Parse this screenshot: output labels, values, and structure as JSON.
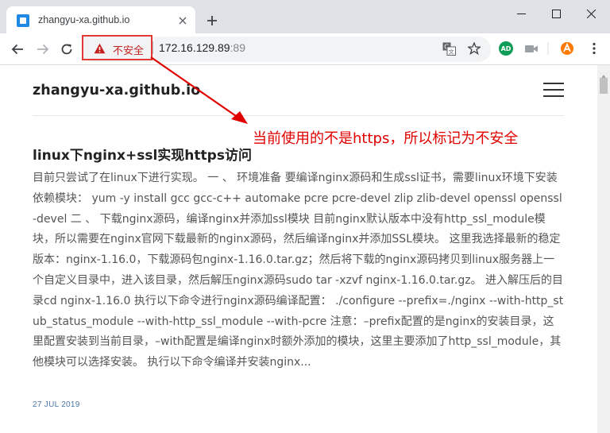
{
  "browser": {
    "tab": {
      "title": "zhangyu-xa.github.io",
      "favicon": "site-favicon"
    },
    "security_label": "不安全",
    "url": {
      "host": "172.16.129.89",
      "port": ":89"
    },
    "colors": {
      "insecure": "#c5221f",
      "annotation": "#e00000",
      "date": "#4a76a8"
    }
  },
  "site": {
    "title": "zhangyu-xa.github.io"
  },
  "post": {
    "title": "linux下nginx+ssl实现https访问",
    "excerpt": "目前只尝试了在linux下进行实现。 一 、 环境准备 要编译nginx源码和生成ssl证书，需要linux环境下安装依赖模块： yum -y install gcc gcc-c++ automake pcre pcre-devel zlip zlib-devel openssl openssl-devel 二 、 下载nginx源码，编译nginx并添加ssl模块 目前nginx默认版本中没有http_ssl_module模块，所以需要在nginx官网下载最新的nginx源码，然后编译nginx并添加SSL模块。 这里我选择最新的稳定版本：nginx-1.16.0，下载源码包nginx-1.16.0.tar.gz；然后将下载的nginx源码拷贝到linux服务器上一个自定义目录中，进入该目录，然后解压nginx源码sudo tar -xzvf nginx-1.16.0.tar.gz。 进入解压后的目录cd nginx-1.16.0 执行以下命令进行nginx源码编译配置： ./configure --prefix=./nginx --with-http_stub_status_module --with-http_ssl_module --with-pcre 注意：–prefix配置的是nginx的安装目录，这里配置安装到当前目录，–with配置是编译nginx时额外添加的模块，这里主要添加了http_ssl_module，其他模块可以选择安装。 执行以下命令编译并安装nginx...",
    "date": "27 JUL 2019"
  },
  "annotation": {
    "text": "当前使用的不是https，所以标记为不安全"
  }
}
